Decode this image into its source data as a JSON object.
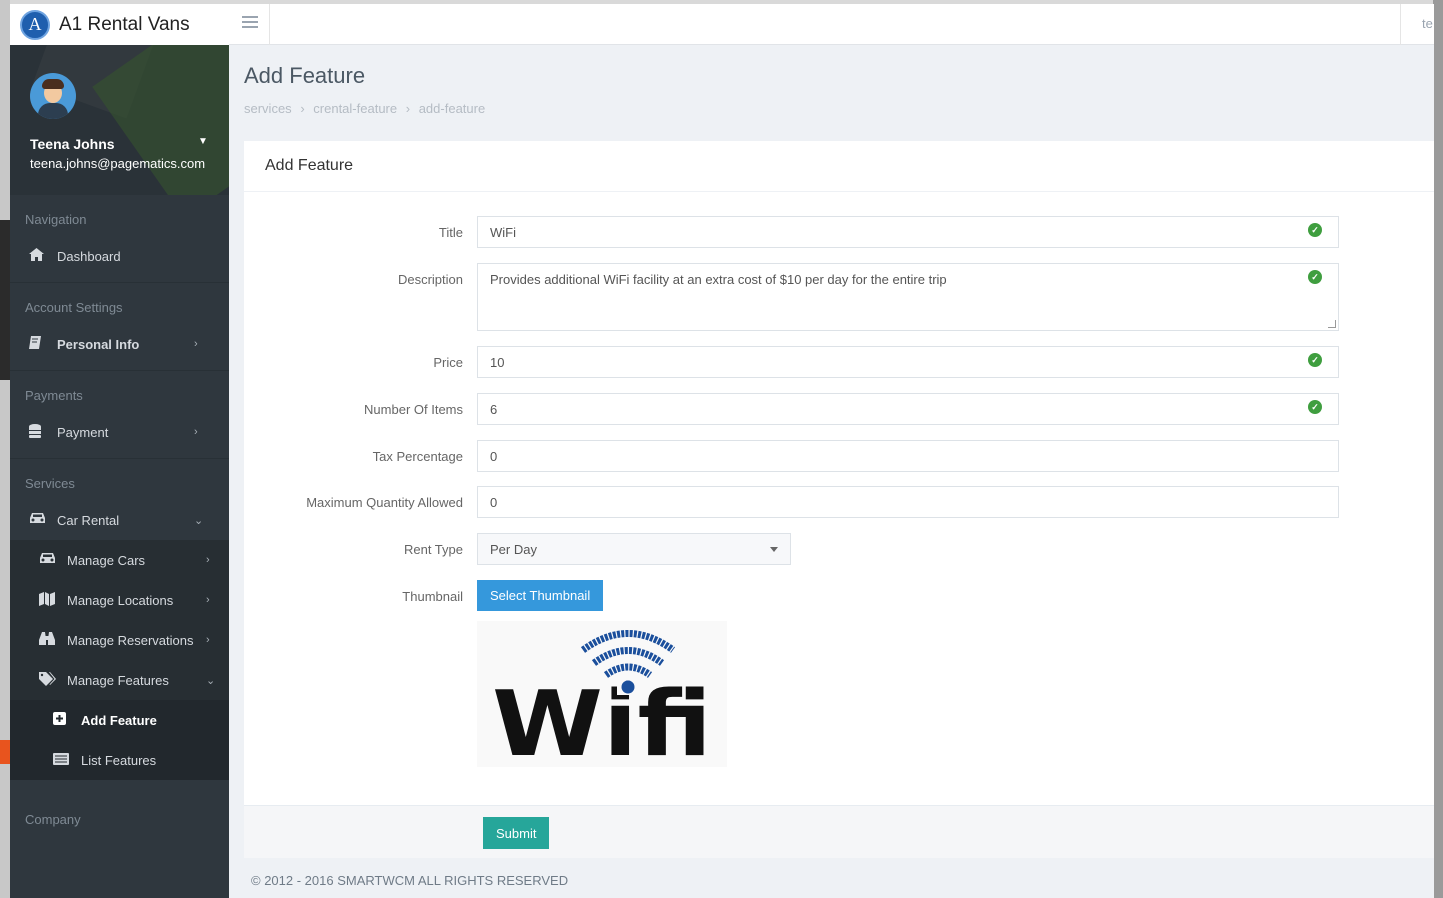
{
  "app": {
    "logo_letter": "A",
    "name": "A1 Rental Vans",
    "topbar_right_text": "te"
  },
  "user": {
    "name": "Teena Johns",
    "email": "teena.johns@pagematics.com"
  },
  "sidebar": {
    "sections": [
      {
        "header": "Navigation",
        "items": [
          {
            "label": "Dashboard",
            "icon": "home-icon"
          }
        ]
      },
      {
        "header": "Account Settings",
        "items": [
          {
            "label": "Personal Info",
            "icon": "book-icon"
          }
        ]
      },
      {
        "header": "Payments",
        "items": [
          {
            "label": "Payment",
            "icon": "database-icon"
          }
        ]
      },
      {
        "header": "Services",
        "items": [
          {
            "label": "Car Rental",
            "icon": "car-icon"
          }
        ]
      },
      {
        "header": "Company"
      }
    ],
    "car_rental_children": [
      {
        "label": "Manage Cars",
        "icon": "car-icon"
      },
      {
        "label": "Manage Locations",
        "icon": "map-icon"
      },
      {
        "label": "Manage Reservations",
        "icon": "binoculars-icon"
      },
      {
        "label": "Manage Features",
        "icon": "tags-icon"
      }
    ],
    "features_children": [
      {
        "label": "Add Feature",
        "icon": "plus-square-icon"
      },
      {
        "label": "List Features",
        "icon": "list-icon"
      }
    ]
  },
  "page": {
    "title": "Add Feature",
    "breadcrumb": [
      "services",
      "crental-feature",
      "add-feature"
    ]
  },
  "panel": {
    "title": "Add Feature"
  },
  "form": {
    "title": {
      "label": "Title",
      "value": "WiFi"
    },
    "description": {
      "label": "Description",
      "value": "Provides additional WiFi facility at an extra cost of $10 per day for the entire trip"
    },
    "price": {
      "label": "Price",
      "value": "10"
    },
    "number_of_items": {
      "label": "Number Of Items",
      "value": "6"
    },
    "tax_percentage": {
      "label": "Tax Percentage",
      "value": "0"
    },
    "max_quantity": {
      "label": "Maximum Quantity Allowed",
      "value": "0"
    },
    "rent_type": {
      "label": "Rent Type",
      "value": "Per Day"
    },
    "thumbnail": {
      "label": "Thumbnail",
      "button": "Select Thumbnail",
      "image_text": "Wifi"
    },
    "submit": "Submit"
  },
  "footer": "© 2012 - 2016 SMARTWCM ALL RIGHTS RESERVED",
  "colors": {
    "sidebar_bg": "#2f373e",
    "primary_blue": "#3598dc",
    "submit_teal": "#26a69a",
    "valid_green": "#3f9e3f",
    "wifi_blue": "#1b4f9c"
  }
}
